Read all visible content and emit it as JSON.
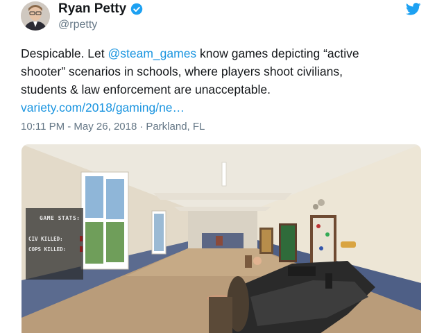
{
  "author": {
    "display_name": "Ryan Petty",
    "handle": "@rpetty",
    "verified_icon": "verified-badge-icon",
    "platform_icon": "twitter-bird-icon"
  },
  "tweet": {
    "line1_text": "Despicable.  Let ",
    "mention": "@steam_games",
    "line1_rest": " know games depicting “active",
    "line2": "shooter” scenarios in schools, where players shoot civilians,",
    "line3": "students & law enforcement are unacceptable.",
    "link": "variety.com/2018/gaming/ne…"
  },
  "meta": {
    "time": "10:11 PM - May 26, 2018",
    "separator": "·",
    "location": "Parkland, FL"
  },
  "media": {
    "game_stats_title": "GAME STATS:",
    "civ_label": "CIV KILLED:",
    "cops_label": "COPS KILLED:"
  },
  "colors": {
    "link": "#1b95e0",
    "text": "#14171a",
    "secondary": "#657786",
    "twitter_blue": "#1da1f2"
  }
}
